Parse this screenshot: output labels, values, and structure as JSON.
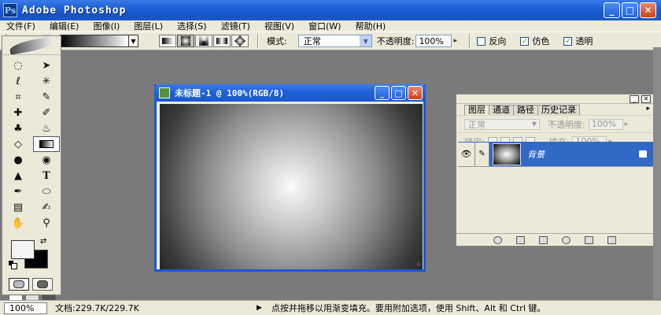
{
  "window": {
    "title": "Adobe Photoshop",
    "app_icon": "Ps"
  },
  "menu": [
    "文件(F)",
    "编辑(E)",
    "图像(I)",
    "图层(L)",
    "选择(S)",
    "滤镜(T)",
    "视图(V)",
    "窗口(W)",
    "帮助(H)"
  ],
  "options": {
    "mode_label": "模式:",
    "mode_value": "正常",
    "opacity_label": "不透明度:",
    "opacity_value": "100%",
    "reverse_label": "反向",
    "dither_label": "仿色",
    "transparency_label": "透明",
    "reverse_checked": false,
    "dither_checked": true,
    "transparency_checked": true
  },
  "document": {
    "title": "未标题-1 @ 100%(RGB/8)"
  },
  "layers_panel": {
    "tabs": [
      "图层",
      "通道",
      "路径",
      "历史记录"
    ],
    "blend_mode": "正常",
    "opacity_label": "不透明度:",
    "opacity_value": "100%",
    "lock_label": "锁定:",
    "fill_label": "填充:",
    "fill_value": "100%",
    "layer_name": "背景"
  },
  "status": {
    "zoom": "100%",
    "doc_info": "文档:229.7K/229.7K",
    "hint": "点按并拖移以用渐变填充。要用附加选项，使用 Shift、Alt 和 Ctrl 键。"
  },
  "colors": {
    "titlebar": "#1d5fd6",
    "workspace": "#7a7a7a",
    "panel": "#ece9d8",
    "layer_selected": "#3169c6"
  }
}
